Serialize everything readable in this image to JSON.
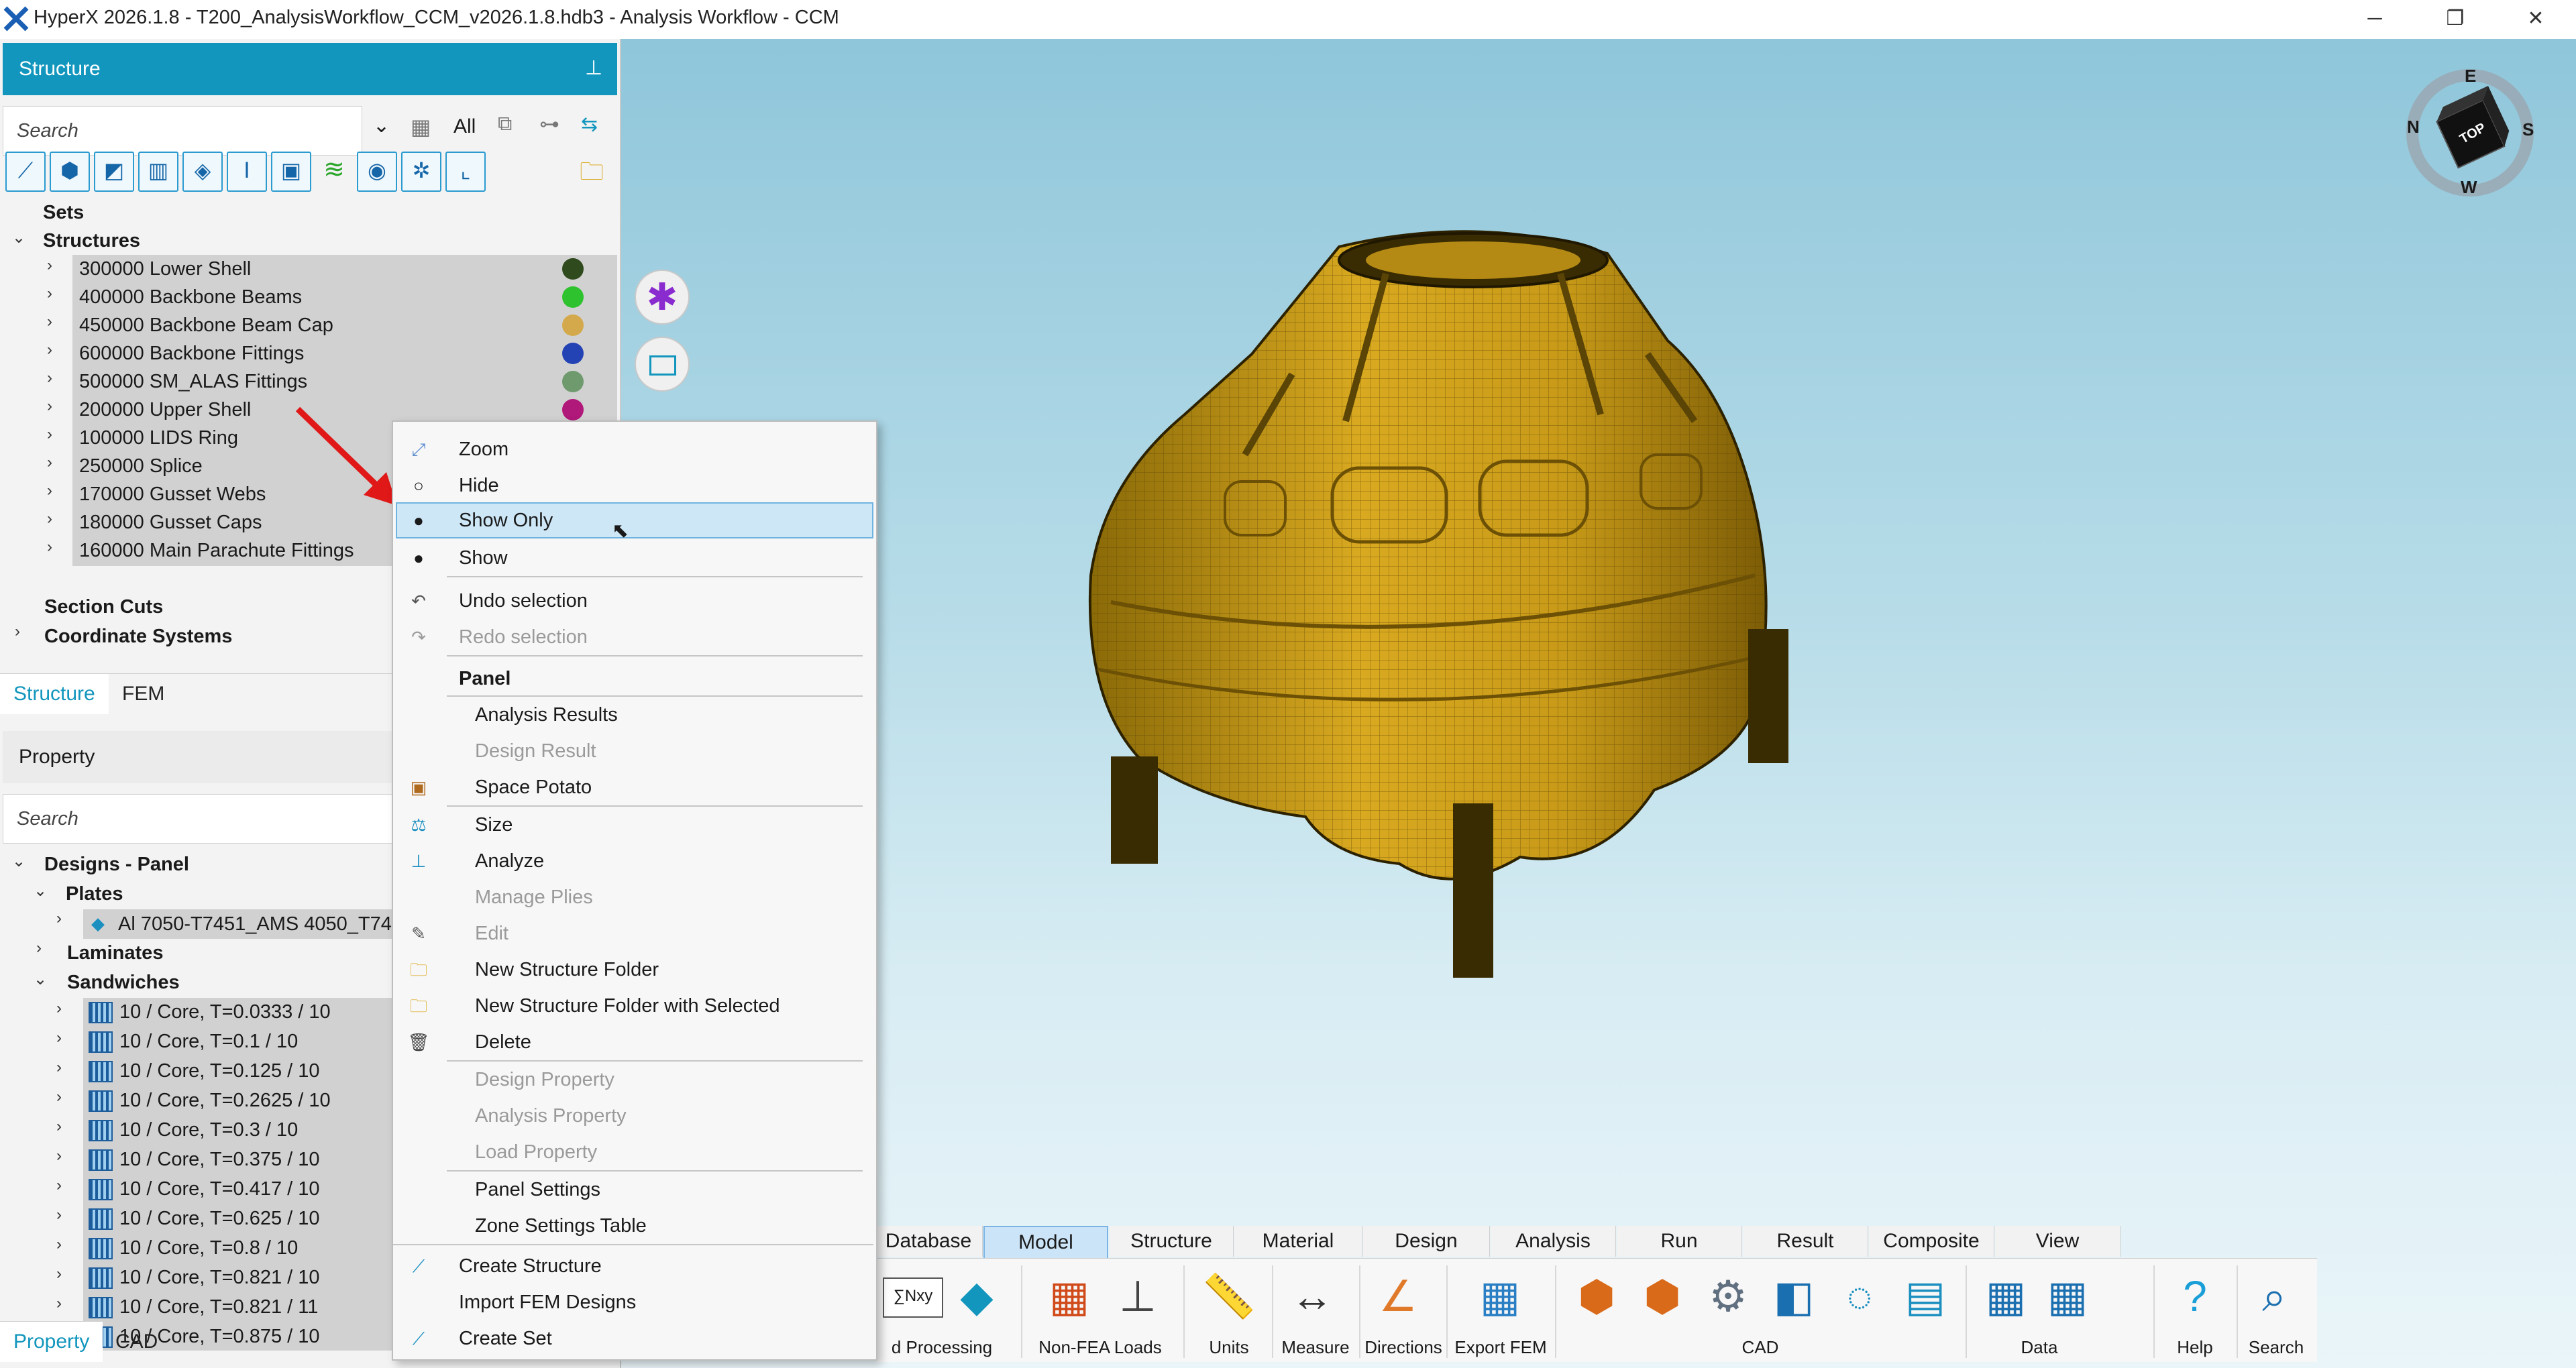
{
  "window": {
    "title": "HyperX 2026.1.8 - T200_AnalysisWorkflow_CCM_v2026.1.8.hdb3 - Analysis Workflow - CCM",
    "minimize": "─",
    "restore": "❐",
    "close": "✕"
  },
  "structure_panel": {
    "title": "Structure",
    "search_placeholder": "Search",
    "filter_label": "All",
    "tree": {
      "sets": "Sets",
      "structures": "Structures",
      "items": [
        {
          "label": "300000 Lower Shell",
          "color": "#2f4a1d"
        },
        {
          "label": "400000 Backbone Beams",
          "color": "#2ec22e"
        },
        {
          "label": "450000 Backbone Beam Cap",
          "color": "#d4a94b"
        },
        {
          "label": "600000 Backbone Fittings",
          "color": "#2342b4"
        },
        {
          "label": "500000 SM_ALAS Fittings",
          "color": "#6e9a6e"
        },
        {
          "label": "200000 Upper Shell",
          "color": "#b0187a"
        },
        {
          "label": "100000 LIDS Ring",
          "color": ""
        },
        {
          "label": "250000 Splice",
          "color": ""
        },
        {
          "label": "170000 Gusset Webs",
          "color": ""
        },
        {
          "label": "180000 Gusset Caps",
          "color": ""
        },
        {
          "label": "160000 Main Parachute Fittings",
          "color": ""
        }
      ],
      "section_cuts": "Section Cuts",
      "coordinate_systems": "Coordinate Systems"
    },
    "tabs": [
      "Structure",
      "FEM"
    ]
  },
  "property_panel": {
    "title": "Property",
    "search_placeholder": "Search",
    "tree": {
      "designs": "Designs - Panel",
      "plates": "Plates",
      "plate_item": "Al 7050-T7451_AMS 4050_T745",
      "laminates": "Laminates",
      "sandwiches": "Sandwiches",
      "sandwich_items": [
        "10 / Core, T=0.0333 / 10",
        "10 / Core, T=0.1 / 10",
        "10 / Core, T=0.125 / 10",
        "10 / Core, T=0.2625 / 10",
        "10 / Core, T=0.3 / 10",
        "10 / Core, T=0.375 / 10",
        "10 / Core, T=0.417 / 10",
        "10 / Core, T=0.625 / 10",
        "10 / Core, T=0.8 / 10",
        "10 / Core, T=0.821 / 10",
        "10 / Core, T=0.821 / 11",
        "10 / Core, T=0.875 / 10"
      ]
    },
    "tabs": [
      "Property",
      "CAD"
    ]
  },
  "context_menu": {
    "zoom": "Zoom",
    "hide": "Hide",
    "show_only": "Show Only",
    "show": "Show",
    "undo": "Undo selection",
    "redo": "Redo selection",
    "panel_header": "Panel",
    "analysis_results": "Analysis Results",
    "design_result": "Design Result",
    "space_potato": "Space Potato",
    "size": "Size",
    "analyze": "Analyze",
    "manage_plies": "Manage Plies",
    "edit": "Edit",
    "new_folder": "New Structure Folder",
    "new_folder_selected": "New Structure Folder with Selected",
    "delete": "Delete",
    "design_property": "Design Property",
    "analysis_property": "Analysis Property",
    "load_property": "Load Property",
    "panel_settings": "Panel Settings",
    "zone_settings": "Zone Settings Table",
    "create_structure": "Create Structure",
    "import_fem": "Import FEM Designs",
    "create_set": "Create Set"
  },
  "ribbon": {
    "tabs": [
      "Database",
      "Model",
      "Structure",
      "Material",
      "Design",
      "Analysis",
      "Run",
      "Result",
      "Composite",
      "View"
    ],
    "active_tab": "Model",
    "groups": [
      "d Processing",
      "Non-FEA Loads",
      "Units",
      "Measure",
      "Directions",
      "Export FEM",
      "CAD",
      "Data",
      "Help",
      "Search"
    ],
    "nxy_label": "∑Nxy"
  },
  "viewcube": {
    "face": "TOP",
    "n": "N",
    "s": "S",
    "e": "E",
    "w": "W"
  },
  "colors": {
    "accent": "#1296bd",
    "model": "#d4a51c"
  }
}
